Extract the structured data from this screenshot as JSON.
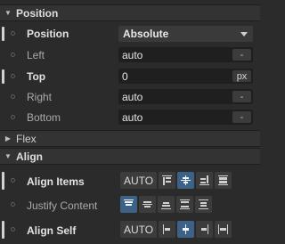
{
  "position_section": {
    "title": "Position",
    "position_row": {
      "label": "Position",
      "value": "Absolute"
    },
    "left_row": {
      "label": "Left",
      "value": "auto",
      "unit": "-"
    },
    "top_row": {
      "label": "Top",
      "value": "0",
      "unit": "px"
    },
    "right_row": {
      "label": "Right",
      "value": "auto",
      "unit": "-"
    },
    "bottom_row": {
      "label": "Bottom",
      "value": "auto",
      "unit": "-"
    }
  },
  "flex_section": {
    "title": "Flex"
  },
  "align_section": {
    "title": "Align",
    "align_items": {
      "label": "Align Items",
      "auto_label": "AUTO",
      "options": [
        "align-start-icon",
        "align-center-icon",
        "align-end-icon",
        "align-stretch-icon"
      ],
      "selected": "align-center-icon"
    },
    "justify_content": {
      "label": "Justify Content",
      "options": [
        "justify-start-icon",
        "justify-center-icon",
        "justify-end-icon",
        "justify-space-between-icon",
        "justify-space-around-icon"
      ],
      "selected": "justify-start-icon"
    },
    "align_self": {
      "label": "Align Self",
      "auto_label": "AUTO",
      "options": [
        "self-start-icon",
        "self-center-icon",
        "self-end-icon",
        "self-stretch-icon"
      ],
      "selected": "self-center-icon"
    }
  },
  "colors": {
    "panel": "#2b2b2b",
    "header": "#333333",
    "field": "#1f1f1f",
    "selected": "#3d6287"
  }
}
